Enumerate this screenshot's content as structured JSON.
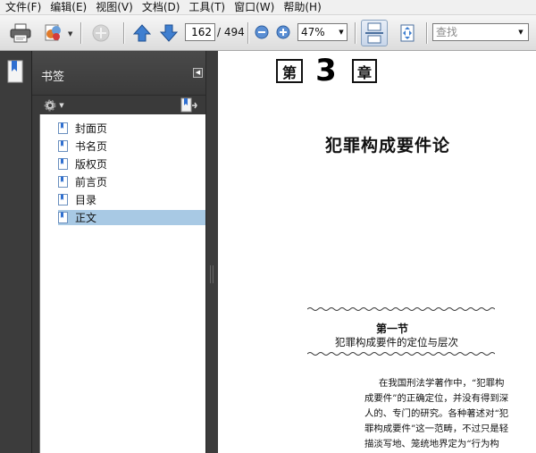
{
  "menu": [
    {
      "label": "文件(F)"
    },
    {
      "label": "编辑(E)"
    },
    {
      "label": "视图(V)"
    },
    {
      "label": "文档(D)"
    },
    {
      "label": "工具(T)"
    },
    {
      "label": "窗口(W)"
    },
    {
      "label": "帮助(H)"
    }
  ],
  "toolbar": {
    "page_current": "162",
    "page_total": "/ 494",
    "zoom": "47%",
    "search_placeholder": "查找",
    "icons": [
      "printer-icon",
      "attach-icon",
      "share-icon",
      "previous-page-icon",
      "next-page-icon",
      "zoom-out-icon",
      "zoom-in-icon",
      "scrolling-mode-icon",
      "fit-page-icon"
    ]
  },
  "bookmarks": {
    "title": "书签",
    "items": [
      {
        "label": "封面页",
        "selected": false
      },
      {
        "label": "书名页",
        "selected": false
      },
      {
        "label": "版权页",
        "selected": false
      },
      {
        "label": "前言页",
        "selected": false
      },
      {
        "label": "目录",
        "selected": false
      },
      {
        "label": "正文",
        "selected": true
      }
    ]
  },
  "document": {
    "chapter_prefix": "第",
    "chapter_number": "3",
    "chapter_suffix": "章",
    "title": "犯罪构成要件论",
    "section_number": "第一节",
    "section_title": "犯罪构成要件的定位与层次",
    "paragraph_lines": [
      "在我国刑法学著作中，“犯罪构",
      "成要件”的正确定位，并没有得到深",
      "人的、专门的研究。各种著述对“犯",
      "罪构成要件”这一范畴，不过只是轻",
      "描淡写地、笼统地界定为“行为构"
    ]
  }
}
